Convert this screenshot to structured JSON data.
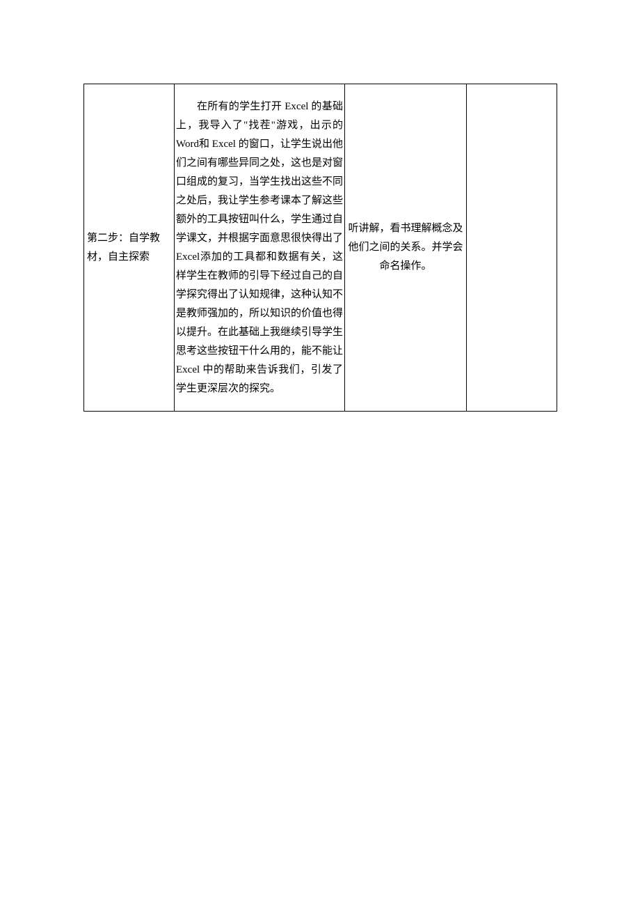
{
  "table": {
    "row": {
      "col1": "第二步：自学教材，自主探索",
      "col2_para1": "在所有的学生打开 Excel 的基础上，我导入了\"找茬\"游戏，出示的 Word和 Excel 的窗口，让学生说出他们之间有哪些异同之处，这也是对窗口组成的复习，当学生找出这些不同之处后，我让学生参考课本了解这些额外的工具按钮叫什么，学生通过自学课文，并根据字面意思很快得出了 Excel添加的工具都和数据有关，这样学生在教师的引导下经过自己的自学探究得出了认知规律，这种认知不是教师强加的，所以知识的价值也得以提升。在此基础上我继续引导学生思考这些按钮干什么用的，能不能让 Excel 中的帮助来告诉我们，引发了学生更深层次的探究。",
      "col3": "听讲解，看书理解概念及他们之间的关系。并学会命名操作。",
      "col4": ""
    }
  }
}
